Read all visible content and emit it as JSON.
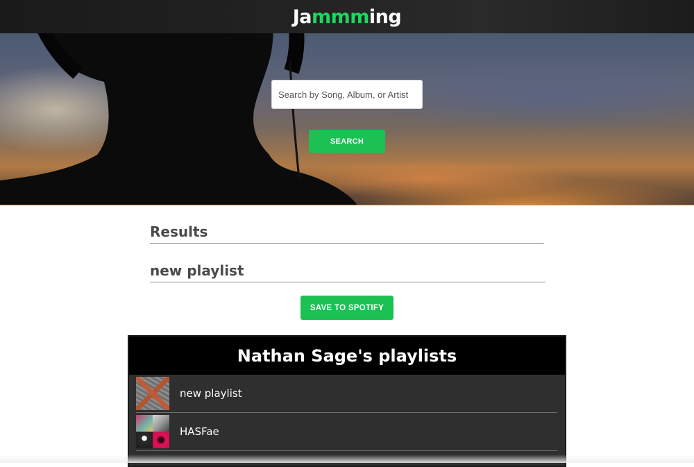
{
  "app": {
    "brand_prefix": "Ja",
    "brand_accent": "mmm",
    "brand_suffix": "ing",
    "accent_color": "#1ed760"
  },
  "search": {
    "placeholder": "Search by Song, Album, or Artist",
    "value": "",
    "button_label": "SEARCH"
  },
  "results": {
    "heading": "Results"
  },
  "playlist": {
    "name": "new playlist",
    "save_label": "SAVE TO SPOTIFY"
  },
  "user_playlists": {
    "title": "Nathan Sage's playlists",
    "items": [
      {
        "name": "new playlist",
        "thumbnail": "album-art-collage-single"
      },
      {
        "name": "HASFae",
        "thumbnail": "album-art-grid-four"
      }
    ]
  },
  "colors": {
    "button_green": "#1cc153",
    "panel_bg": "#2f2f2f",
    "panel_header_bg": "#000000"
  }
}
